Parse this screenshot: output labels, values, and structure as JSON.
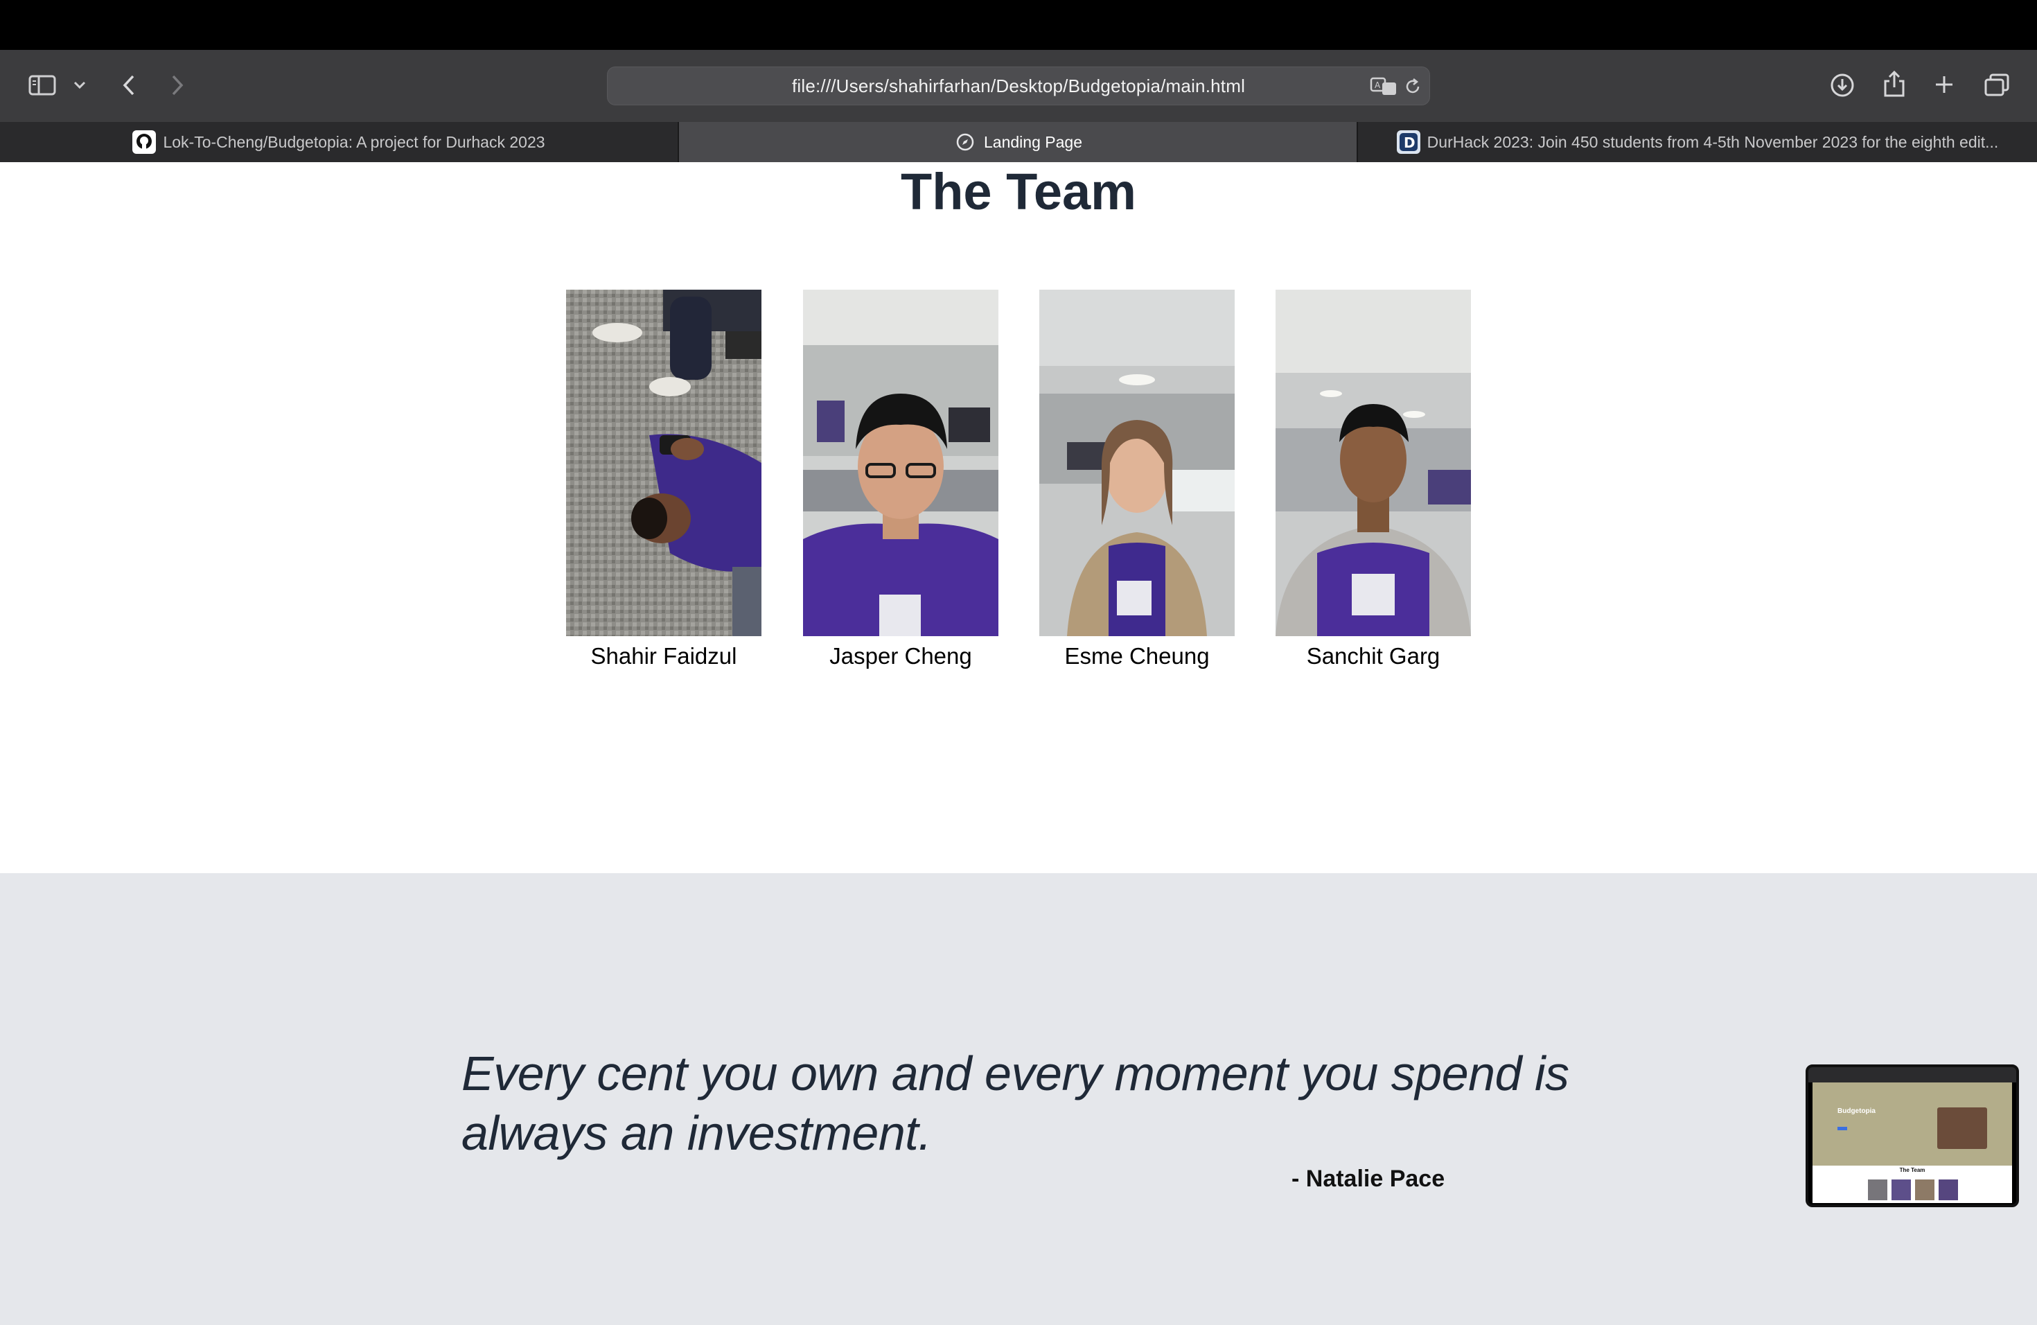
{
  "browser": {
    "url": "file:///Users/shahirfarhan/Desktop/Budgetopia/main.html",
    "tabs": [
      {
        "label": "Lok-To-Cheng/Budgetopia: A project for Durhack 2023",
        "icon": "github-icon",
        "active": false
      },
      {
        "label": "Landing Page",
        "icon": "compass-icon",
        "active": true
      },
      {
        "label": "DurHack 2023: Join 450 students from 4-5th November 2023 for the eighth edit...",
        "icon": "durhack-d-icon",
        "active": false
      }
    ]
  },
  "team": {
    "title": "The Team",
    "members": [
      {
        "name": "Shahir Faidzul",
        "photo": "photo-person-lying-on-floor"
      },
      {
        "name": "Jasper Cheng",
        "photo": "photo-person-glasses-purple-shirt"
      },
      {
        "name": "Esme Cheung",
        "photo": "photo-person-cardigan-purple-shirt"
      },
      {
        "name": "Sanchit Garg",
        "photo": "photo-person-hoodie-purple-shirt"
      }
    ]
  },
  "quote": {
    "text": "Every cent you own and every moment you spend is always an investment.",
    "author": "- Natalie Pace"
  },
  "thumbnail": {
    "hero_title": "Budgetopia",
    "section_title": "The Team"
  },
  "colors": {
    "heading": "#1f2937",
    "quote_bg": "#e5e7eb",
    "purple_shirt": "#4b2e9a"
  }
}
